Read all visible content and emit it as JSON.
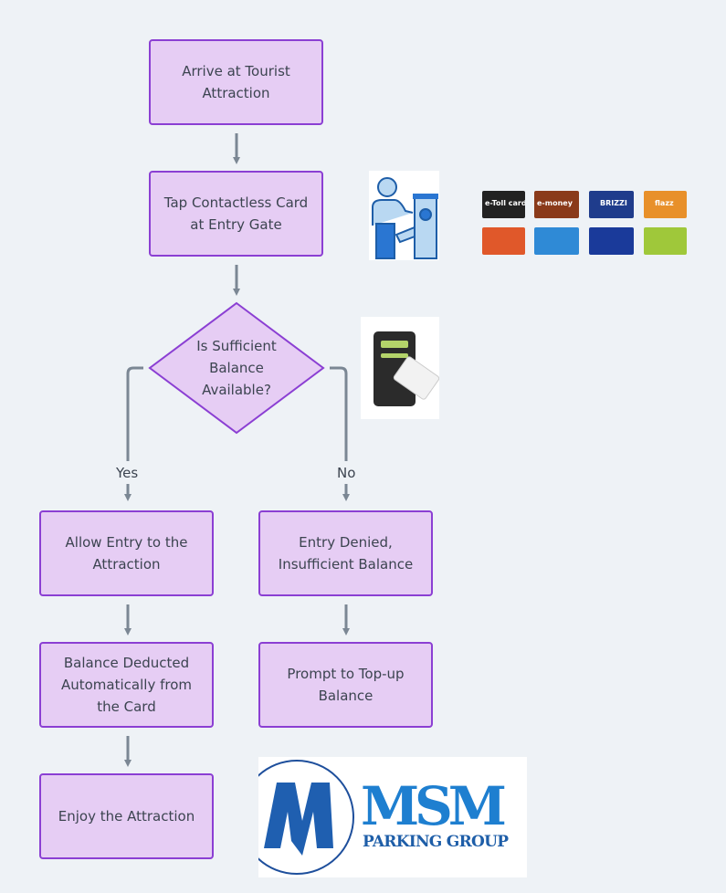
{
  "nodes": {
    "arrive": "Arrive at Tourist Attraction",
    "tap": "Tap Contactless Card at Entry Gate",
    "decision": "Is Sufficient Balance Available?",
    "allow": "Allow Entry to the Attraction",
    "deduct": "Balance Deducted Automatically from the Card",
    "enjoy": "Enjoy the Attraction",
    "denied": "Entry Denied, Insufficient Balance",
    "topup": "Prompt to Top-up Balance"
  },
  "edges": {
    "yes": "Yes",
    "no": "No"
  },
  "images": {
    "card_labels": [
      "e-Toll card",
      "e-money",
      "BRIZZI",
      "flazz"
    ],
    "logo": {
      "title": "MSM",
      "subtitle": "PARKING GROUP"
    }
  },
  "colors": {
    "node_fill": "#e6cdf4",
    "node_border": "#8b3fd3",
    "connector": "#7b8794",
    "background": "#eef2f6"
  }
}
